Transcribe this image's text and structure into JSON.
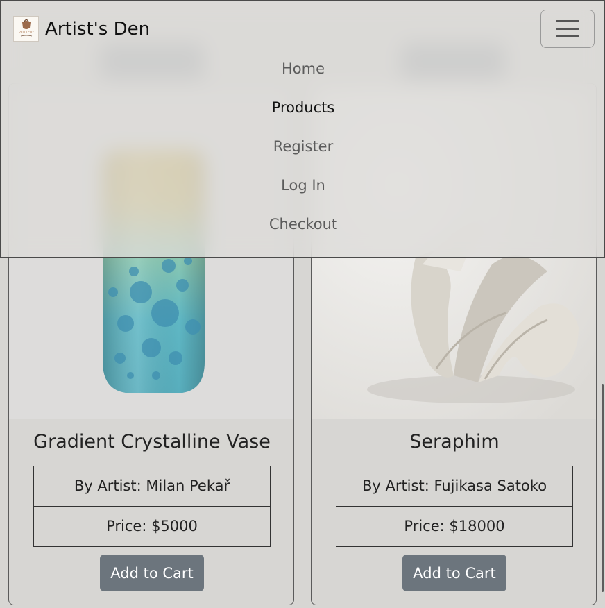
{
  "navbar": {
    "brand": "Artist's Den",
    "logo_text": "POTTERY",
    "toggler_icon": "hamburger-icon",
    "items": [
      {
        "label": "Home",
        "active": false
      },
      {
        "label": "Products",
        "active": true
      },
      {
        "label": "Register",
        "active": false
      },
      {
        "label": "Log In",
        "active": false
      },
      {
        "label": "Checkout",
        "active": false
      }
    ]
  },
  "products": [
    {
      "title": "Gradient Crystalline Vase",
      "artist": "By Artist: Milan Pekař",
      "price": "Price: $5000",
      "button": "Add to Cart"
    },
    {
      "title": "Seraphim",
      "artist": "By Artist: Fujikasa Satoko",
      "price": "Price: $18000",
      "button": "Add to Cart"
    }
  ],
  "colors": {
    "background": "#d7d6d3",
    "button": "#6c757d",
    "vase_teal": "#5fb7c4",
    "vase_yellow": "#c9b24a"
  }
}
